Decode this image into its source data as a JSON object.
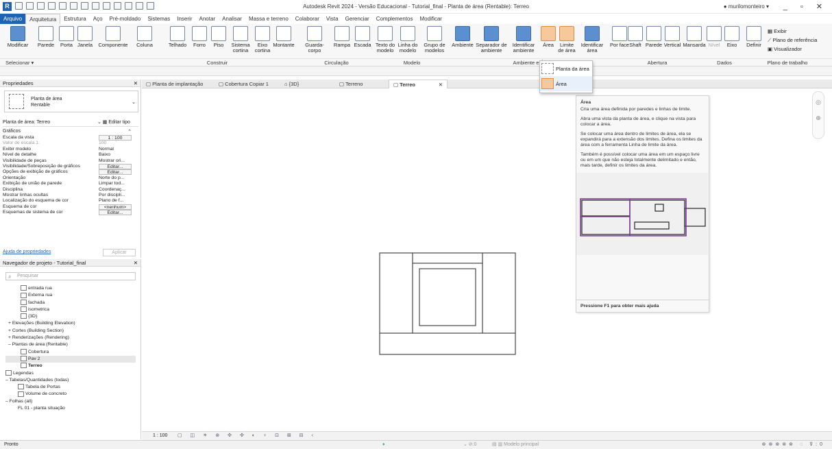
{
  "app": {
    "title": "Autodesk Revit 2024 - Versão Educacional - Tutorial_final - Planta de área (Rentable): Terreo",
    "user": "murilomonteiro"
  },
  "tabs": [
    "Arquivo",
    "Arquitetura",
    "Estrutura",
    "Aço",
    "Pré-moldado",
    "Sistemas",
    "Inserir",
    "Anotar",
    "Analisar",
    "Massa e terreno",
    "Colaborar",
    "Vista",
    "Gerenciar",
    "Complementos",
    "Modificar"
  ],
  "ribbon": {
    "buttons": [
      "Modificar",
      "Parede",
      "Porta",
      "Janela",
      "Componente",
      "Coluna",
      "Telhado",
      "Forro",
      "Piso",
      "Sistema cortina",
      "Eixo cortina",
      "Montante",
      "Guarda-corpo",
      "Rampa",
      "Escada",
      "Texto do modelo",
      "Linha do modelo",
      "Grupo de modelos",
      "Ambiente",
      "Separador de ambiente",
      "Identificar ambiente",
      "Área",
      "Limite de área",
      "Identificar área",
      "Por face",
      "Shaft",
      "Parede",
      "Vertical",
      "Mansarda",
      "Nível",
      "Eixo",
      "Definir"
    ],
    "right": [
      "Exibir",
      "Plano de referência",
      "Visualizador"
    ],
    "panels": [
      "Selecionar ▾",
      "Construir",
      "Circulação",
      "Modelo",
      "Ambiente e Á",
      "Abertura",
      "Dados",
      "Plano de trabalho"
    ]
  },
  "dropdown": [
    "Planta da área",
    "Área"
  ],
  "properties": {
    "title": "Propriedades",
    "type_name": "Planta de área",
    "type_sub": "Rentable",
    "selector": "Planta de área: Terreo",
    "edit_type": "Editar tipo",
    "group": "Gráficos",
    "apply": "Aplicar",
    "help_link": "Ajuda de propriedades",
    "rows": [
      {
        "k": "Escala da vista",
        "v": "1 : 100"
      },
      {
        "k": "Valor de escala    1:",
        "v": "100"
      },
      {
        "k": "Exibir modelo",
        "v": "Normal"
      },
      {
        "k": "Nível de detalhe",
        "v": "Baixo"
      },
      {
        "k": "Visibilidade de peças",
        "v": "Mostrar ori..."
      },
      {
        "k": "Visibilidade/Sobreposição de gráficos",
        "v": "Editar..."
      },
      {
        "k": "Opções de exibição de gráficos",
        "v": "Editar..."
      },
      {
        "k": "Orientação",
        "v": "Norte do p..."
      },
      {
        "k": "Exibição de união de parede",
        "v": "Limpar tod..."
      },
      {
        "k": "Disciplina",
        "v": "Coordenaç..."
      },
      {
        "k": "Mostrar linhas ocultas",
        "v": "Por discipli..."
      },
      {
        "k": "Localização do esquema de cor",
        "v": "Plano de f..."
      },
      {
        "k": "Esquema de cor",
        "v": "<nenhum>"
      },
      {
        "k": "Esquemas de sistema de cor",
        "v": "Editar..."
      }
    ]
  },
  "browser": {
    "title": "Navegador de projeto - Tutorial_final",
    "search": "Pesquisar",
    "items": [
      "entrada rua",
      "Externa rua",
      "fachada",
      "isometrica",
      "{3D}",
      "+ Elevações (Building Elevation)",
      "+ Cortes (Building Section)",
      "+ Renderizações (Rendering)",
      "– Plantas de área (Rentable)",
      "Cobertura",
      "Pav 2",
      "Terreo",
      "Legendas",
      "– Tabelas/Quantidades (todas)",
      "Tabela de Portas",
      "Volume de concreto",
      "– Folhas (all)",
      "FL 01 - planta situação"
    ]
  },
  "viewtabs": [
    "Planta de implantação",
    "Cobertura Copiar 1",
    "{3D}",
    "Terreno",
    "Terreo"
  ],
  "tooltip": {
    "title": "Área",
    "p1": "Cria uma área definida por paredes e linhas de limite.",
    "p2": "Abra uma vista da planta de área, e clique na vista para colocar a área.",
    "p3": "Se colocar uma área dentro de limites de área, ela se expandirá para a extensão dos limites. Defina os limites da área com a ferramenta Linha de limite da área.",
    "p4": "Também é possível colocar uma área em um espaço livre ou em um que não esteja totalmente delimitado e então, mais tarde, definir os limites da área.",
    "footer": "Pressione F1 para obter mais ajuda"
  },
  "viewbar": {
    "scale": "1 : 100"
  },
  "status": {
    "left": "Pronto",
    "model": "Modelo principal",
    "count": ":0"
  }
}
